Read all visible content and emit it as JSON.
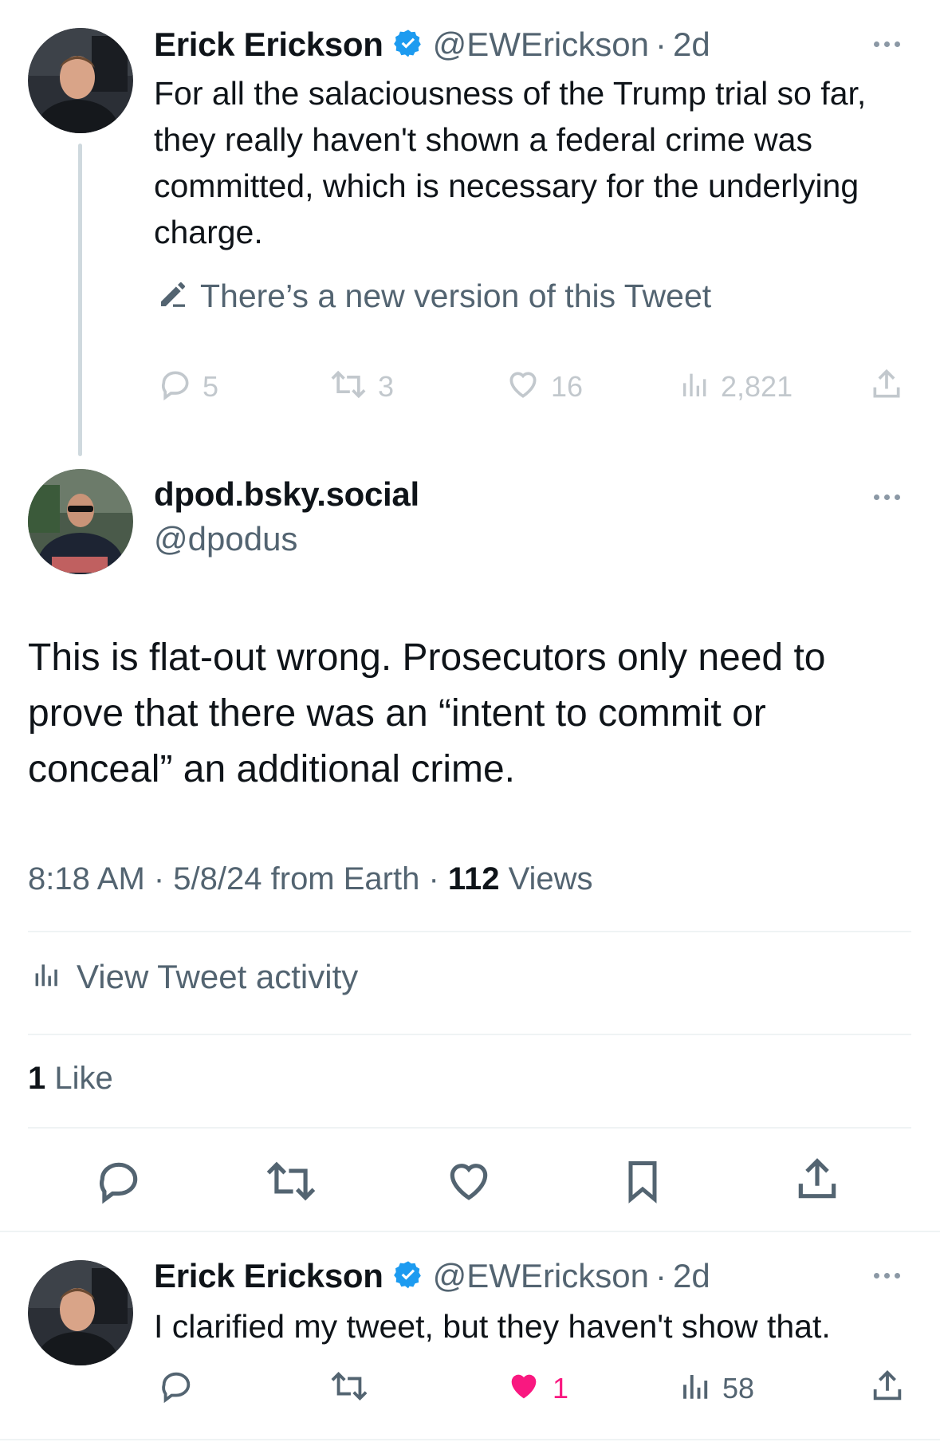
{
  "tweet1": {
    "author_name": "Erick Erickson",
    "handle": "@EWErickson",
    "separator": "·",
    "age": "2d",
    "text": "For all the salaciousness of the Trump trial so far, they really haven't shown a federal crime was committed, which is necessary for the underlying charge.",
    "new_version_notice": "There’s a new version of this Tweet",
    "replies": "5",
    "retweets": "3",
    "likes": "16",
    "views": "2,821"
  },
  "main_tweet": {
    "author_name": "dpod.bsky.social",
    "handle": "@dpodus",
    "text": "This is flat-out wrong. Prosecutors only need to prove that there was an “intent to commit or conceal” an additional crime.",
    "timestamp": "8:18 AM · 5/8/24 from Earth · ",
    "views_count": "112",
    "views_label": "Views",
    "activity_label": "View Tweet activity",
    "like_count": "1",
    "like_label": "Like"
  },
  "reply": {
    "author_name": "Erick Erickson",
    "handle": "@EWErickson",
    "separator": "·",
    "age": "2d",
    "text": "I clarified my tweet, but they haven't show that.",
    "likes": "1",
    "views": "58"
  },
  "colors": {
    "verified": "#1d9bf0",
    "like_active": "#f91880",
    "muted": "#536471",
    "divider": "#eff3f4"
  },
  "icons": [
    "verified-badge-icon",
    "more-dots-icon",
    "pencil-icon",
    "reply-icon",
    "retweet-icon",
    "heart-icon",
    "views-icon",
    "share-icon",
    "bookmark-icon"
  ]
}
